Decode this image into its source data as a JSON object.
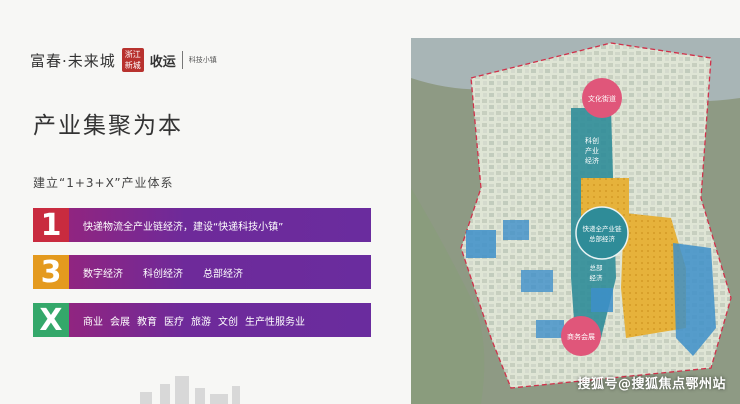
{
  "logo": {
    "main": "富春·未来城",
    "seal": "浙江 新城",
    "brand": "收运",
    "sub": "科技小镇"
  },
  "title": "产业集聚为本",
  "subtitle": "建立“1+3+X”产业体系",
  "bands": [
    {
      "key": "1",
      "items": [
        "快递物流全产业链经济，建设“快递科技小镇”"
      ]
    },
    {
      "key": "3",
      "items": [
        "数字经济",
        "科创经济",
        "总部经济"
      ]
    },
    {
      "key": "X",
      "items": [
        "商业",
        "会展",
        "教育",
        "医疗",
        "旅游",
        "文创",
        "生产性服务业"
      ]
    }
  ],
  "map": {
    "zones": {
      "culture": "文化街道",
      "tech": [
        "科创",
        "产业",
        "经济"
      ],
      "express": [
        "快递全产业链",
        "总部经济"
      ],
      "hq": [
        "总部",
        "经济"
      ],
      "business": "商务会展"
    }
  },
  "watermark": "搜狐号@搜狐焦点鄂州站",
  "colors": {
    "band_red": "#c92b3f",
    "band_orange": "#e49a1e",
    "band_green": "#34a86a",
    "band_purple": "#6a2c9e",
    "zone_pink": "#e0567a",
    "zone_teal": "#2f8c98",
    "zone_yellow": "#e6b23b",
    "zone_blue": "#3d8fc9"
  }
}
